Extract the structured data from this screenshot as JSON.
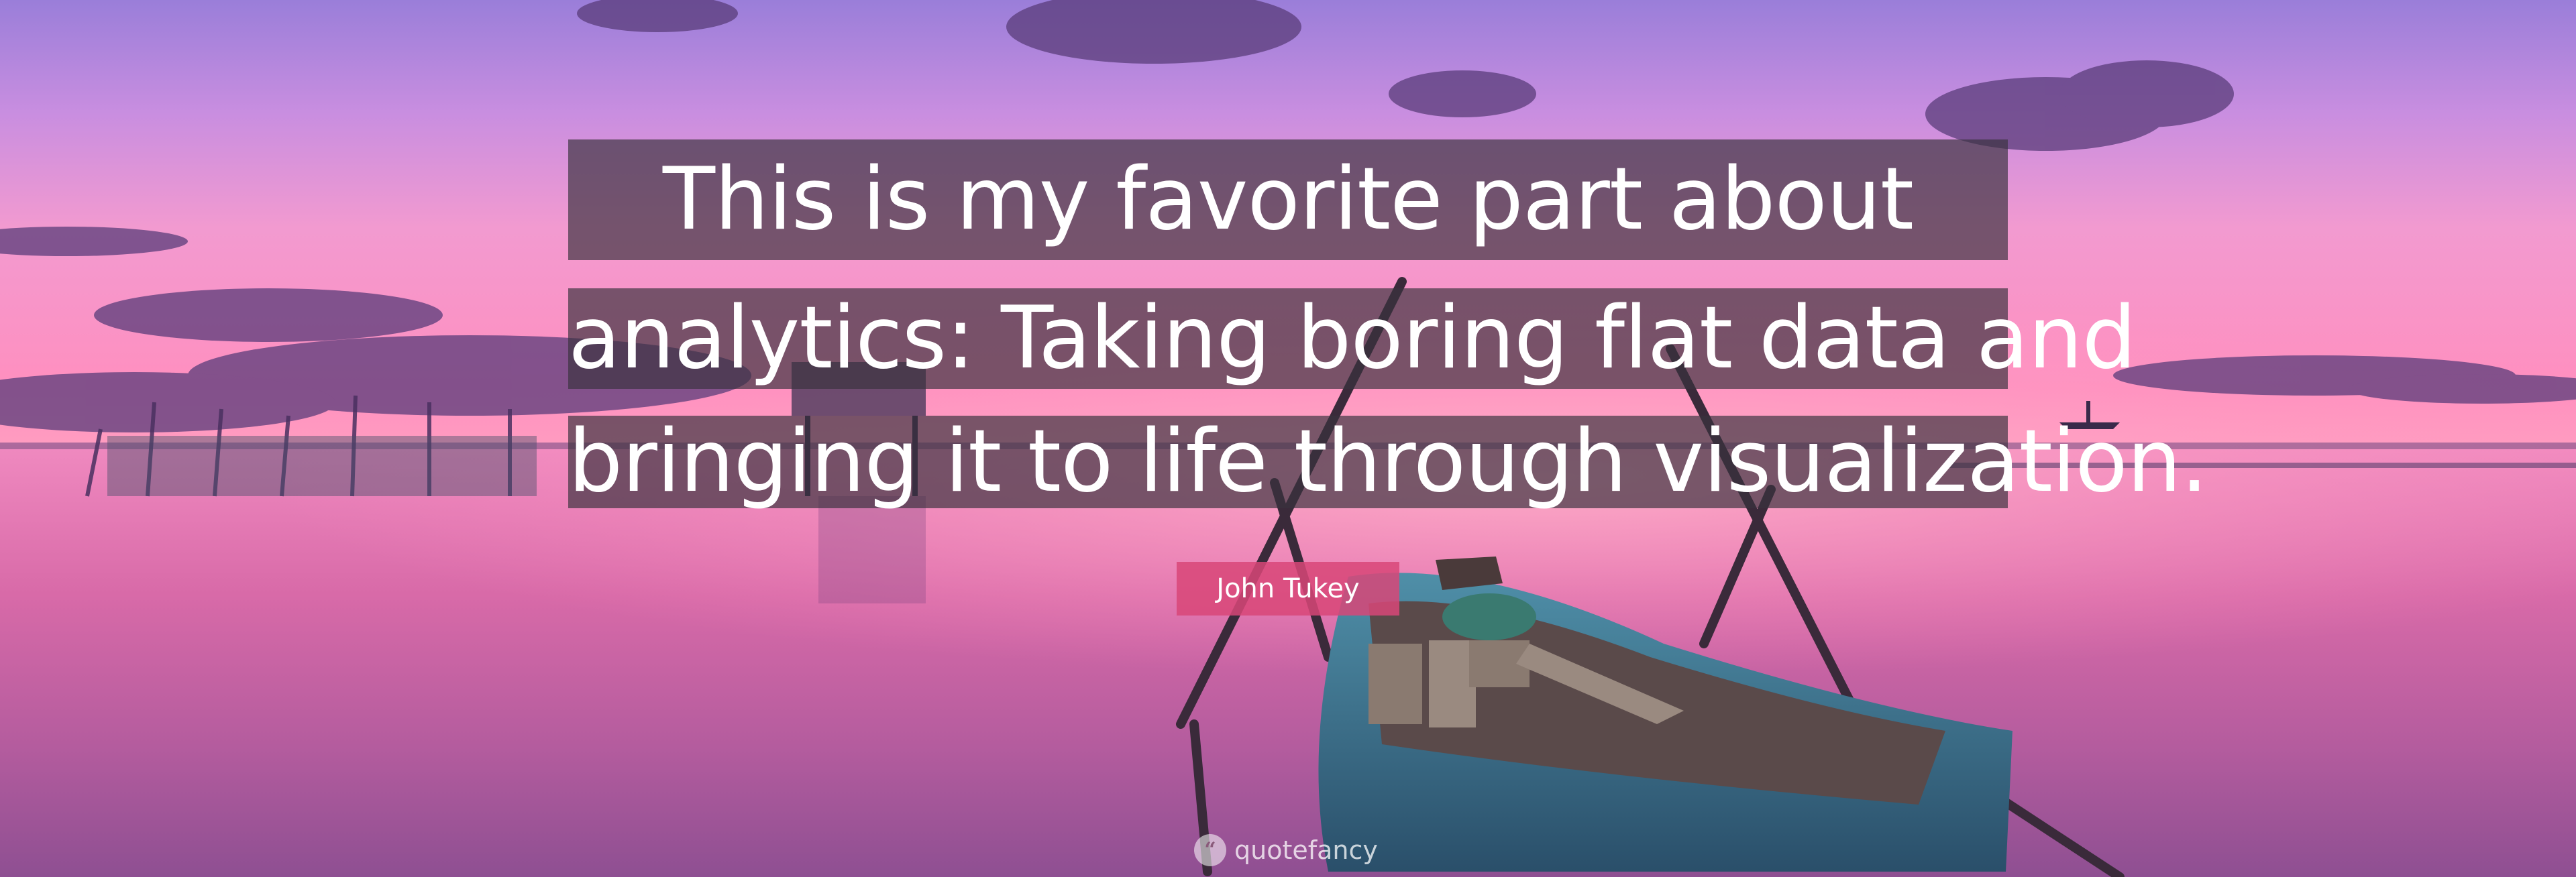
{
  "quote": {
    "lines": [
      "This is my favorite part about",
      "analytics: Taking boring flat data and",
      "bringing it to life through visualization."
    ]
  },
  "author": "John Tukey",
  "brand": {
    "name": "quotefancy",
    "icon": "quote-mark-icon"
  },
  "colors": {
    "sky_top": "#a88be0",
    "sky_pink": "#f08cc8",
    "horizon": "#ff7fb0",
    "water": "#d46aa0",
    "author_tag": "#d84678",
    "quote_band": "#3a323e"
  }
}
